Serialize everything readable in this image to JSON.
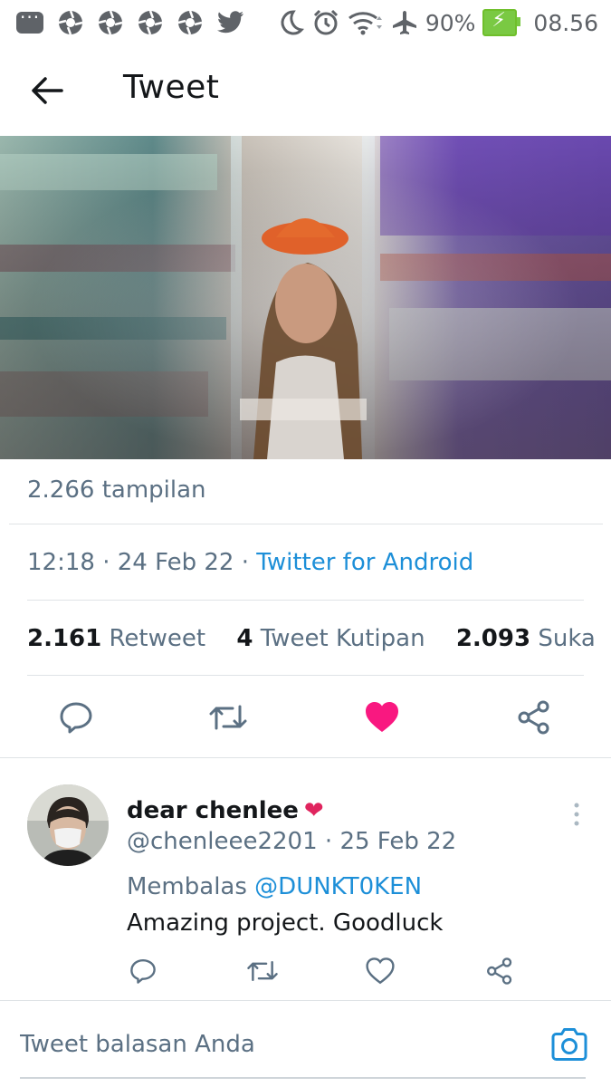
{
  "status_bar": {
    "battery_percent": "90%",
    "time": "08.56",
    "icons": [
      "message-icon",
      "aperture-icon",
      "aperture-icon",
      "aperture-icon",
      "aperture-icon",
      "twitter-icon",
      "moon-icon",
      "alarm-icon",
      "wifi-icon",
      "airplane-icon",
      "battery-charging-icon"
    ]
  },
  "header": {
    "title": "Tweet",
    "back_icon": "arrow-left-icon"
  },
  "tweet": {
    "views": "2.266 tampilan",
    "time": "12:18",
    "date": "24 Feb 22",
    "separator": "·",
    "source": "Twitter for Android",
    "stats": {
      "retweets_count": "2.161",
      "retweets_label": "Retweet",
      "quotes_count": "4",
      "quotes_label": "Tweet Kutipan",
      "likes_count": "2.093",
      "likes_label": "Suka"
    },
    "liked": true,
    "colors": {
      "like": "#f91880",
      "link": "#1d8fd8"
    }
  },
  "reply": {
    "display_name": "dear chenlee",
    "name_emoji": "❤",
    "handle": "@chenleee2201",
    "date": "25 Feb 22",
    "separator": "·",
    "replying_label": "Membalas",
    "replying_to": "@DUNKT0KEN",
    "text": "Amazing project. Goodluck"
  },
  "compose": {
    "placeholder": "Tweet balasan Anda"
  }
}
